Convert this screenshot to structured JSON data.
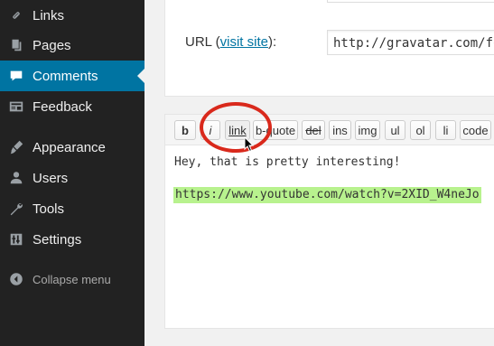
{
  "sidebar": {
    "items": [
      {
        "label": "Links",
        "icon": "link-icon"
      },
      {
        "label": "Pages",
        "icon": "pages-icon"
      },
      {
        "label": "Comments",
        "icon": "comments-icon",
        "current": true
      },
      {
        "label": "Feedback",
        "icon": "feedback-icon"
      },
      {
        "label": "Appearance",
        "icon": "appearance-icon"
      },
      {
        "label": "Users",
        "icon": "users-icon"
      },
      {
        "label": "Tools",
        "icon": "tools-icon"
      },
      {
        "label": "Settings",
        "icon": "settings-icon"
      }
    ],
    "collapse_label": "Collapse menu"
  },
  "form": {
    "url_label_prefix": "URL (",
    "visit_site": "visit site",
    "url_label_suffix": "):",
    "url_value": "http://gravatar.com/fo"
  },
  "toolbar": {
    "buttons": [
      "b",
      "i",
      "link",
      "b-quote",
      "del",
      "ins",
      "img",
      "ul",
      "ol",
      "li",
      "code"
    ]
  },
  "editor": {
    "line1": "Hey, that is pretty interesting!",
    "link": "https://www.youtube.com/watch?v=2XID_W4neJo"
  },
  "colors": {
    "sidebar_bg": "#222222",
    "current_bg": "#0074a2",
    "highlight": "#b8f28e",
    "annotation": "#d9291c"
  }
}
